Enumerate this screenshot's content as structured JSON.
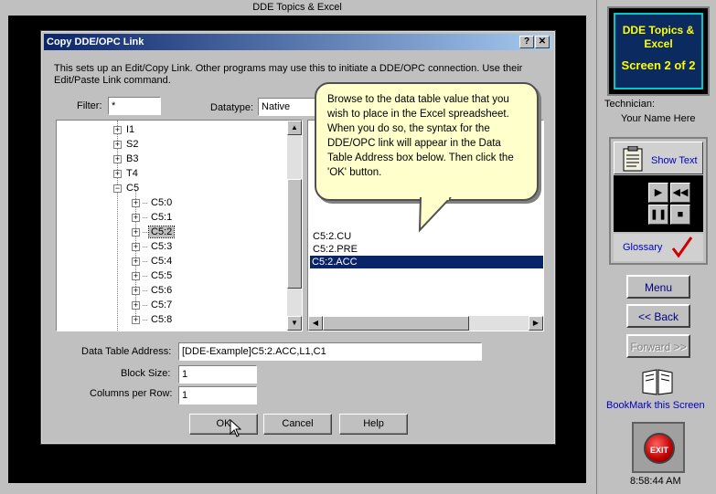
{
  "window": {
    "title": "DDE Topics & Excel"
  },
  "dialog": {
    "title": "Copy DDE/OPC Link",
    "help_btn": "?",
    "close_btn": "✕",
    "description": "This sets up an Edit/Copy Link.  Other programs may use this to initiate a DDE/OPC connection.  Use their Edit/Paste Link command.",
    "filter_label": "Filter:",
    "filter_value": "*",
    "datatype_label": "Datatype:",
    "datatype_value": "Native",
    "tree": [
      "I1",
      "S2",
      "B3",
      "T4",
      "C5",
      "C5:0",
      "C5:1",
      "C5:2",
      "C5:3",
      "C5:4",
      "C5:5",
      "C5:6",
      "C5:7",
      "C5:8"
    ],
    "list": [
      "C5:2.CU",
      "C5:2.PRE",
      "C5:2.ACC"
    ],
    "address_label": "Data Table Address:",
    "address_value": "[DDE-Example]C5:2.ACC,L1,C1",
    "block_label": "Block Size:",
    "block_value": "1",
    "columns_label": "Columns per Row:",
    "columns_value": "1",
    "ok": "OK",
    "cancel": "Cancel",
    "help": "Help"
  },
  "callout": "Browse to the data table value that you wish to place in the Excel spreadsheet.  When you do so, the syntax for the DDE/OPC link will appear in the Data Table Address box below.  Then click the 'OK' button.",
  "sidebar": {
    "screen_title": "DDE Topics & Excel",
    "screen_num": "Screen 2 of 2",
    "tech_label": "Technician:",
    "tech_name": "Your Name Here",
    "show_text": "Show Text",
    "glossary": "Glossary",
    "menu": "Menu",
    "back": "<< Back",
    "forward": "Forward >>",
    "bookmark": "BookMark this Screen",
    "exit": "EXIT",
    "clock": "8:58:44 AM"
  }
}
